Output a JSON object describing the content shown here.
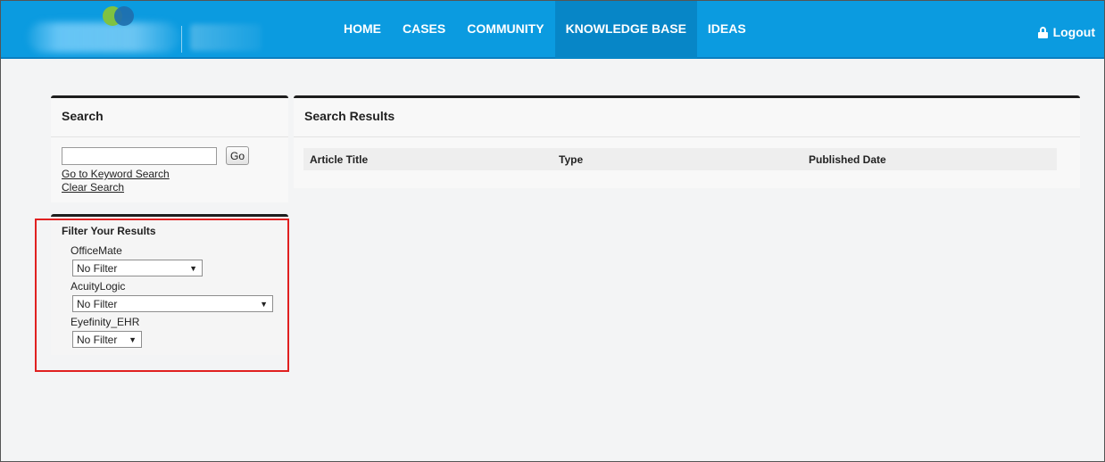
{
  "nav": {
    "items": [
      {
        "label": "HOME",
        "active": false
      },
      {
        "label": "CASES",
        "active": false
      },
      {
        "label": "COMMUNITY",
        "active": false
      },
      {
        "label": "KNOWLEDGE BASE",
        "active": true
      },
      {
        "label": "IDEAS",
        "active": false
      }
    ],
    "logout_label": "Logout"
  },
  "search": {
    "title": "Search",
    "input_value": "",
    "go_label": "Go",
    "keyword_link": "Go to Keyword Search",
    "clear_link": "Clear Search"
  },
  "filter": {
    "title": "Filter Your Results",
    "groups": [
      {
        "label": "OfficeMate",
        "selected": "No Filter"
      },
      {
        "label": "AcuityLogic",
        "selected": "No Filter"
      },
      {
        "label": "Eyefinity_EHR",
        "selected": "No Filter"
      }
    ]
  },
  "results": {
    "title": "Search Results",
    "columns": [
      "Article Title",
      "Type",
      "Published Date"
    ]
  },
  "colors": {
    "header_bg": "#0b9be0",
    "nav_active_bg": "#0786c7",
    "highlight_border": "#e02020"
  }
}
